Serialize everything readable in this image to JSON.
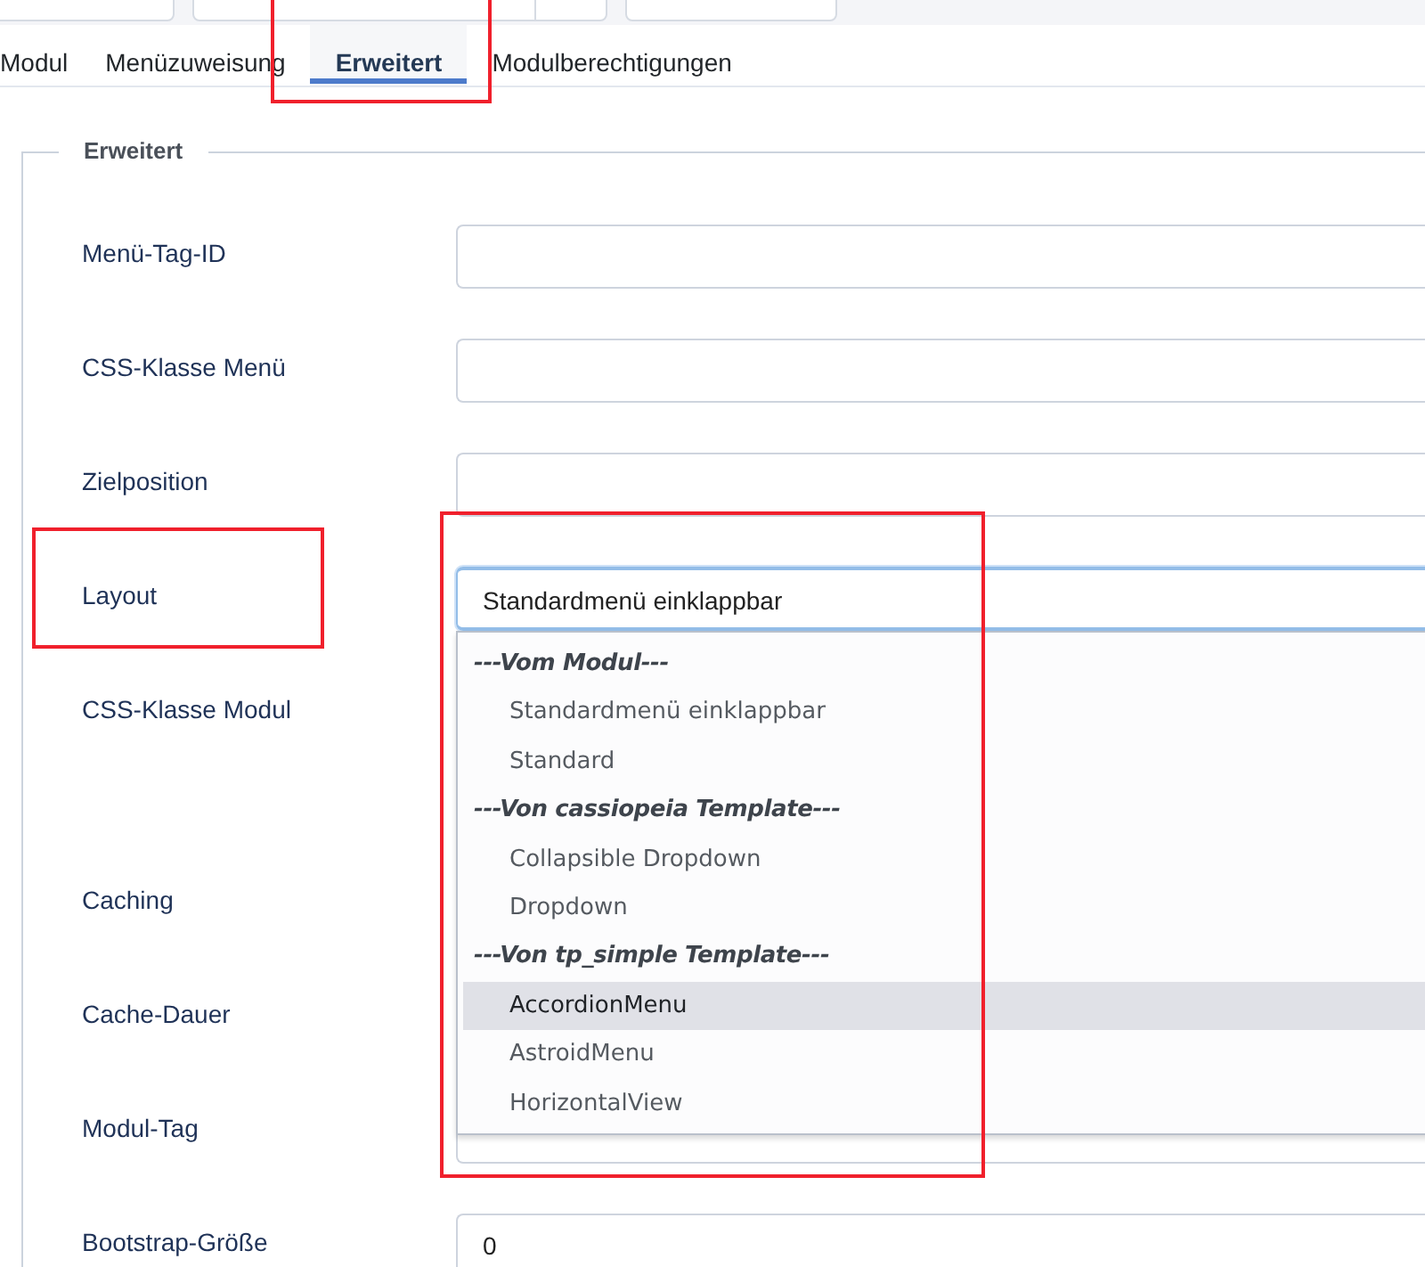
{
  "tabs": [
    {
      "label": "Modul",
      "selected": false
    },
    {
      "label": "Menüzuweisung",
      "selected": false
    },
    {
      "label": "Erweitert",
      "selected": true,
      "marked": true
    },
    {
      "label": "Modulberechtigungen",
      "selected": false
    }
  ],
  "fieldset": {
    "legend": "Erweitert",
    "fields": [
      {
        "label": "Menü-Tag-ID",
        "kind": "text"
      },
      {
        "label": "CSS-Klasse Menü",
        "kind": "text"
      },
      {
        "label": "Zielposition",
        "kind": "text"
      },
      {
        "label": "Layout",
        "kind": "select",
        "value": "Standardmenü einklappbar",
        "focused": true,
        "marked": true
      },
      {
        "label": "CSS-Klasse Modul",
        "kind": "covered"
      },
      {
        "label": "Caching",
        "kind": "covered"
      },
      {
        "label": "Cache-Dauer",
        "kind": "covered"
      },
      {
        "label": "Modul-Tag",
        "kind": "covered-field"
      },
      {
        "label": "Bootstrap-Größe",
        "kind": "text",
        "value": "0"
      }
    ]
  },
  "dropdown": {
    "marked": true,
    "options": [
      {
        "kind": "group",
        "label": "---Vom Modul---"
      },
      {
        "kind": "option",
        "label": "Standardmenü einklappbar",
        "selected": false
      },
      {
        "kind": "option",
        "label": "Standard",
        "selected": false
      },
      {
        "kind": "group",
        "label": "---Von cassiopeia Template---"
      },
      {
        "kind": "option",
        "label": "Collapsible Dropdown",
        "selected": false
      },
      {
        "kind": "option",
        "label": "Dropdown",
        "selected": false
      },
      {
        "kind": "group",
        "label": "---Von tp_simple Template---"
      },
      {
        "kind": "option",
        "label": "AccordionMenu",
        "selected": true
      },
      {
        "kind": "option",
        "label": "AstroidMenu",
        "selected": false
      },
      {
        "kind": "option",
        "label": "HorizontalView",
        "selected": false
      }
    ]
  }
}
